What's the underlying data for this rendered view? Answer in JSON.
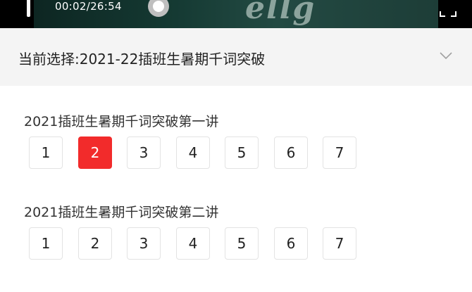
{
  "player": {
    "time": "00:02/26:54",
    "watermark": "ellg",
    "progress_fraction": 0.0012
  },
  "selector": {
    "text": "当前选择:2021-22插班生暑期千词突破"
  },
  "sections": [
    {
      "title": "2021插班生暑期千词突破第一讲",
      "episodes": [
        "1",
        "2",
        "3",
        "4",
        "5",
        "6",
        "7"
      ],
      "active_index": 1
    },
    {
      "title": "2021插班生暑期千词突破第二讲",
      "episodes": [
        "1",
        "2",
        "3",
        "4",
        "5",
        "6",
        "7"
      ],
      "active_index": -1
    }
  ],
  "colors": {
    "active": "#f22b2b",
    "player_bg": "#000000",
    "selector_bg": "#f4f4f4"
  },
  "icons": {
    "pause": "pause-icon",
    "progress": "progress-thumb",
    "fullscreen": "fullscreen-icon",
    "dropdown": "chevron-down-icon"
  }
}
